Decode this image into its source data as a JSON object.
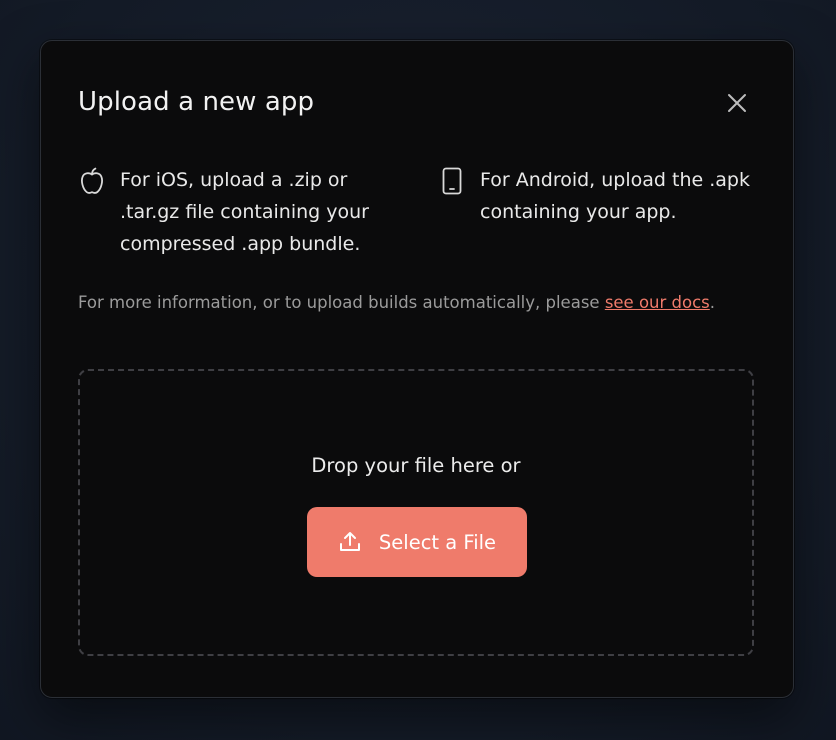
{
  "modal": {
    "title": "Upload a new app",
    "close_icon": "close-icon"
  },
  "platforms": {
    "ios": {
      "icon": "apple-icon",
      "text": "For iOS, upload a .zip or .tar.gz file containing your compressed .app bundle."
    },
    "android": {
      "icon": "phone-icon",
      "text": "For Android, upload the .apk containing your app."
    }
  },
  "info": {
    "prefix": "For more information, or to upload builds automatically, please ",
    "link_text": "see our docs",
    "suffix": "."
  },
  "dropzone": {
    "prompt": "Drop your file here or",
    "button_label": "Select a File",
    "button_icon": "upload-icon"
  },
  "colors": {
    "accent": "#ef7b6b",
    "modal_background": "#0b0b0c",
    "page_background": "#161d2a",
    "muted_text": "#9b9b9b"
  }
}
